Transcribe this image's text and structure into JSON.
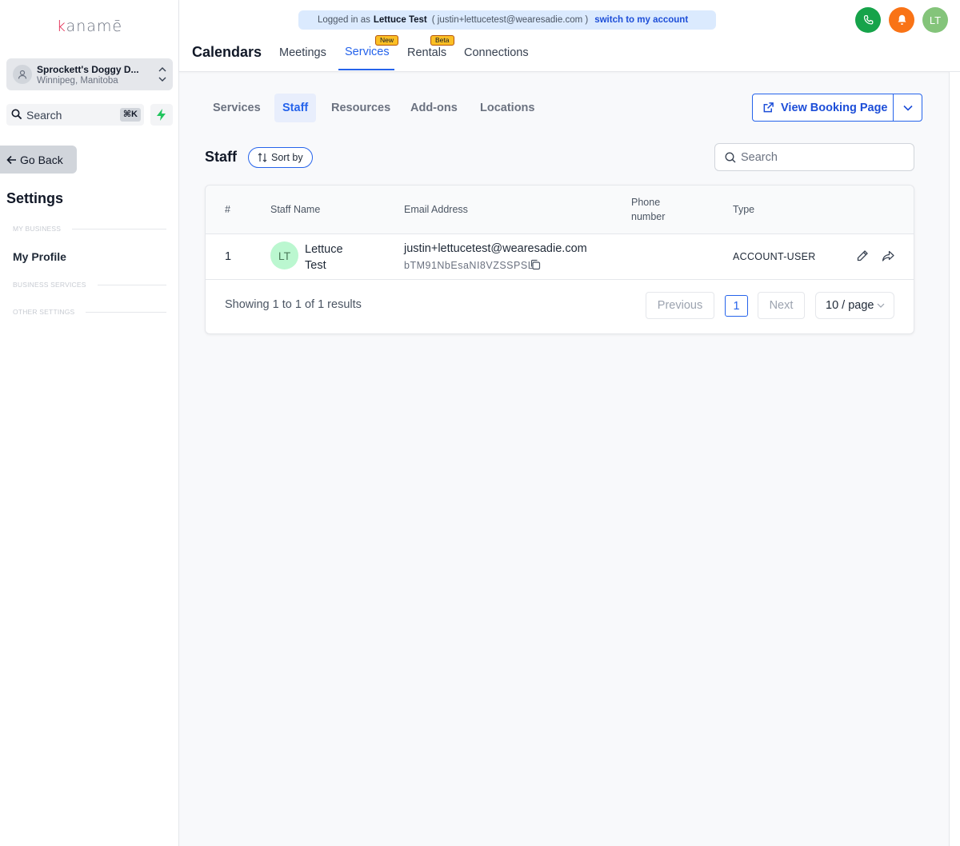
{
  "sidebar": {
    "logo_k": "k",
    "logo_rest": "anamē",
    "business": {
      "name": "Sprockett's Doggy D...",
      "location": "Winnipeg, Manitoba"
    },
    "search": {
      "label": "Search",
      "shortcut": "⌘K"
    },
    "go_back": "Go Back",
    "settings_title": "Settings",
    "sections": {
      "my_business": "MY BUSINESS",
      "business_services": "BUSINESS SERVICES",
      "other_settings": "OTHER SETTINGS"
    },
    "my_profile": "My Profile"
  },
  "header": {
    "banner": {
      "prefix": "Logged in as",
      "user": "Lettuce Test",
      "email": "( justin+lettucetest@wearesadie.com )",
      "switch": "switch to my account"
    },
    "avatar_initials": "LT",
    "page_title": "Calendars",
    "tabs": [
      {
        "label": "Meetings"
      },
      {
        "label": "Services",
        "badge": "New"
      },
      {
        "label": "Rentals",
        "badge": "Beta"
      },
      {
        "label": "Connections"
      }
    ],
    "active_tab": "Services",
    "colors": {
      "accent": "#2563eb",
      "phone": "#16a34a",
      "bell": "#f97316",
      "avatar": "#84c47a",
      "badge": "#fbbf24"
    }
  },
  "subtabs": [
    "Services",
    "Staff",
    "Resources",
    "Add-ons",
    "Locations"
  ],
  "active_subtab": "Staff",
  "view_booking_page": "View Booking Page",
  "staff": {
    "title": "Staff",
    "sort_label": "Sort by",
    "search_placeholder": "Search",
    "columns": {
      "num": "#",
      "name": "Staff Name",
      "email": "Email Address",
      "phone_1": "Phone",
      "phone_2": "number",
      "type": "Type"
    },
    "rows": [
      {
        "num": "1",
        "initials": "LT",
        "name_1": "Lettuce",
        "name_2": "Test",
        "email": "justin+lettucetest@wearesadie.com",
        "id_code": "bTM91NbEsaNI8VZSSPSL",
        "phone": "",
        "type": "ACCOUNT-USER"
      }
    ],
    "footer": {
      "summary": "Showing 1 to 1 of 1 results",
      "previous": "Previous",
      "page": "1",
      "next": "Next",
      "per_page": "10 / page"
    }
  }
}
